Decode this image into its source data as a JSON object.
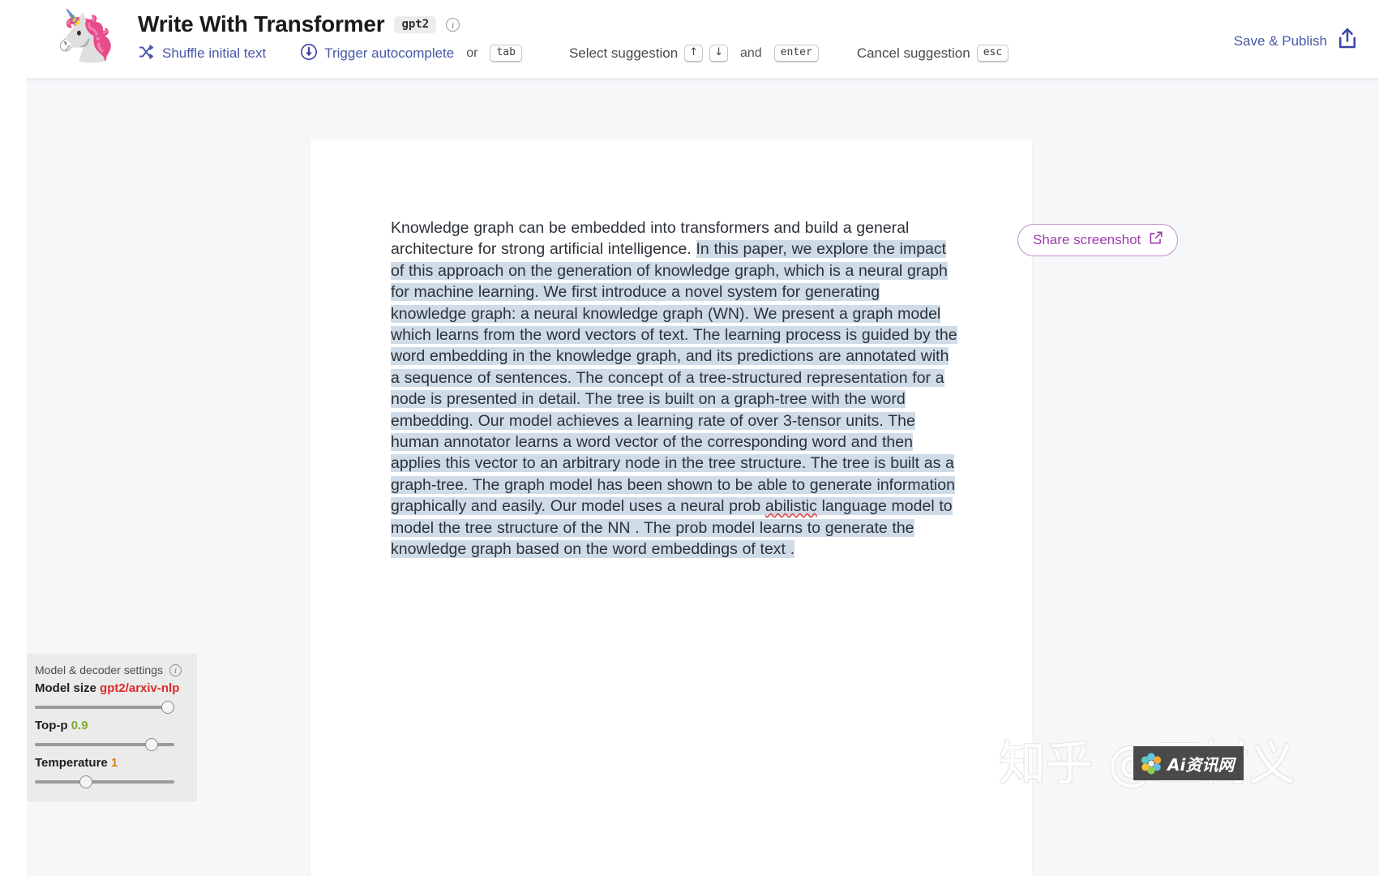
{
  "header": {
    "logo_icon": "unicorn-emoji",
    "logo_glyph": "🦄",
    "title": "Write With Transformer",
    "model_badge": "gpt2",
    "info_glyph": "i",
    "hints": [
      {
        "icon": "shuffle-icon",
        "label": "Shuffle initial text",
        "keys": [],
        "connector": ""
      },
      {
        "icon": "download-circle-icon",
        "label": "Trigger autocomplete",
        "connector": "or",
        "keys": [
          "tab"
        ]
      },
      {
        "icon": "",
        "label": "Select suggestion",
        "keys": [
          "↑",
          "↓"
        ],
        "connector": "and",
        "extra_key": "enter"
      },
      {
        "icon": "",
        "label": "Cancel suggestion",
        "keys": [
          "esc"
        ],
        "connector": ""
      }
    ],
    "save_publish": {
      "label": "Save & Publish",
      "icon": "share-upload-icon"
    }
  },
  "document": {
    "seed_text": "Knowledge graph can be embedded into transformers and build a general architecture for strong artificial intelligence. ",
    "generated_parts": [
      {
        "text": "In this paper, we explore the impact of this approach on the generation of knowledge graph, which is a neural graph for machine learning. We first introduce a novel system for generating knowledge graph: a neural knowledge graph (WN).  We present a graph model which learns from the word vectors of text. The learning process is guided by the word embedding in the knowledge graph, and its predictions are annotated with  a sequence of sentences. The concept of a tree-structured representation for a node is presented in detail. The tree is built on a graph-tree with the word embedding. Our model achieves a learning rate of over 3-tensor units. The human annotator learns a word vector of the corresponding  word and then applies this vector to an arbitrary node in the tree structure. The tree is built as a graph-tree. The graph model has been shown to be able to generate information graphically and easily. Our model uses a neural prob ",
        "misspelled": false
      },
      {
        "text": "abilistic",
        "misspelled": true
      },
      {
        "text": " language model to model the tree structure of the NN . The prob model learns  to generate the knowledge graph based on the word embeddings of text .",
        "misspelled": false
      }
    ]
  },
  "share_button": {
    "label": "Share screenshot",
    "icon": "external-link-icon"
  },
  "settings": {
    "panel_title": "Model & decoder settings",
    "info_glyph": "i",
    "rows": [
      {
        "label": "Model size",
        "value": "gpt2/arxiv-nlp",
        "value_color": "#dd2b2b",
        "thumb_percent": 100
      },
      {
        "label": "Top-p",
        "value": "0.9",
        "value_color": "#7fa832",
        "thumb_percent": 87
      },
      {
        "label": "Temperature",
        "value": "1",
        "value_color": "#d98513",
        "thumb_percent": 32
      }
    ]
  },
  "watermark": {
    "text": "知乎 @王树义",
    "badge_text": "Ai资讯网"
  },
  "colors": {
    "accent_blue": "#4858a8",
    "accent_purple": "#9b3fae",
    "highlight": "#cfdce8",
    "workspace_bg": "#f6f7f9"
  }
}
